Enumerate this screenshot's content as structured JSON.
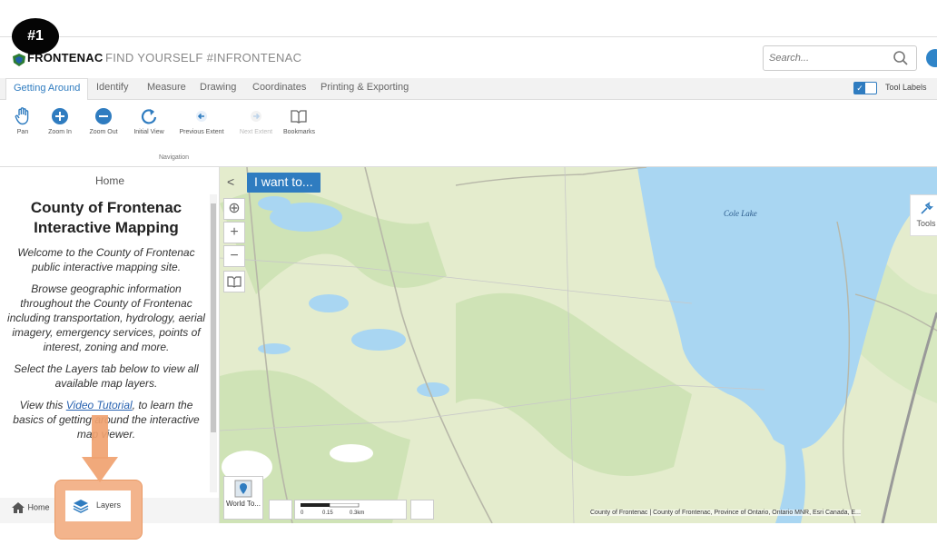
{
  "step_badge": "#1",
  "header": {
    "brand": "FRONTENAC",
    "tagline": "FIND YOURSELF #INFRONTENAC",
    "search_placeholder": "Search..."
  },
  "tabs": [
    "Getting Around",
    "Identify",
    "Measure",
    "Drawing",
    "Coordinates",
    "Printing & Exporting"
  ],
  "tool_labels": "Tool Labels",
  "toolbar": {
    "tools": [
      "Pan",
      "Zoom In",
      "Zoom Out",
      "Initial View",
      "Previous Extent",
      "Next Extent",
      "Bookmarks"
    ],
    "group_label": "Navigation"
  },
  "panel": {
    "header": "Home",
    "title": "County of Frontenac Interactive Mapping",
    "p1": "Welcome to the County of Frontenac public interactive mapping site.",
    "p2": "Browse geographic information throughout the County of Frontenac including transportation, hydrology, aerial imagery, emergency services, points of interest, zoning and more.",
    "p3": "Select the Layers tab below to view all available map layers.",
    "p4_pre": "View this ",
    "p4_link": "Video Tutorial",
    "p4_post": ", to learn the basics of getting around the interactive map viewer."
  },
  "bottom_tabs": {
    "home": "Home",
    "layers": "Layers"
  },
  "map": {
    "i_want_to": "I want to...",
    "tools": "Tools",
    "lake_label": "Cole Lake",
    "basemap": "World To...",
    "scale": [
      "0",
      "0.15",
      "0.3km"
    ],
    "attribution": "County of Frontenac | County of Frontenac, Province of Ontario, Ontario MNR, Esri Canada, E..."
  },
  "colors": {
    "accent": "#2f7cc0",
    "highlight": "#f3b48c",
    "water": "#a9d6f2",
    "land": "#e4eccd",
    "forest": "#cfe3b6"
  }
}
